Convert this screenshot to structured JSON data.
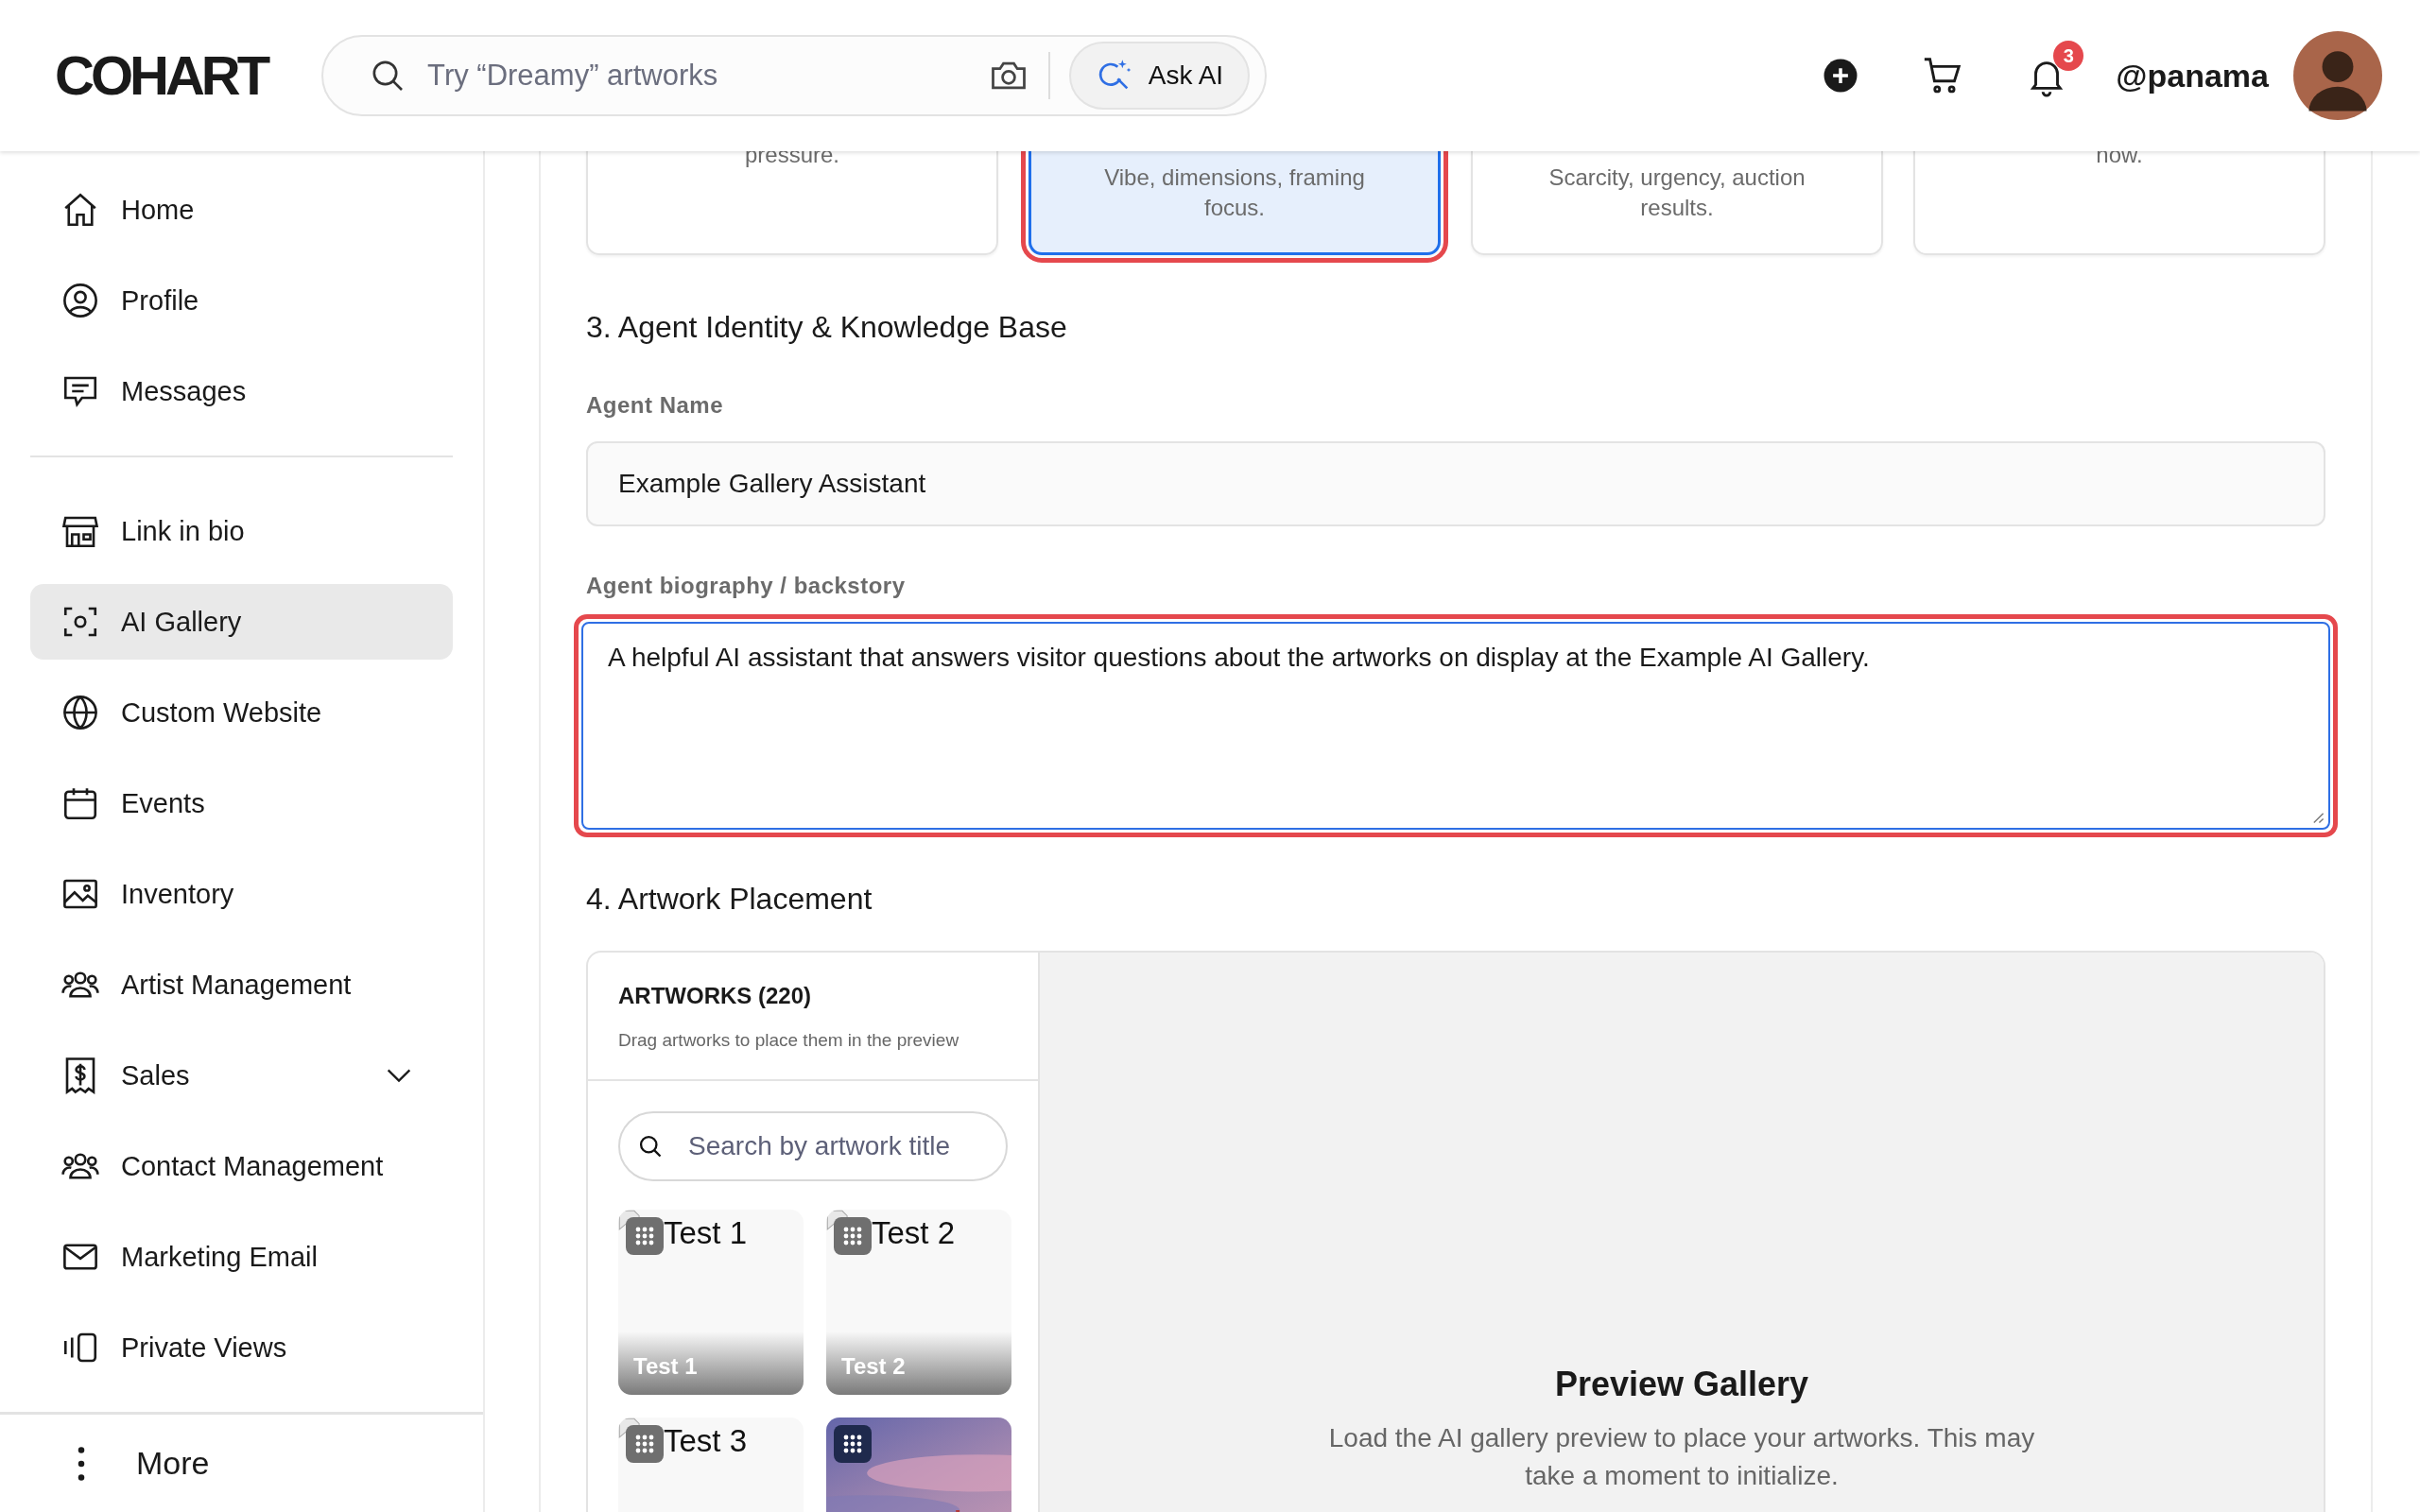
{
  "header": {
    "logo": "COHART",
    "search": {
      "placeholder": "Try “Dreamy” artworks"
    },
    "ask_ai": "Ask AI",
    "notifications": "3",
    "username": "@panama"
  },
  "sidebar": {
    "groups": [
      [
        {
          "label": "Home",
          "selected": false
        },
        {
          "label": "Profile",
          "selected": false
        },
        {
          "label": "Messages",
          "selected": false
        }
      ],
      [
        {
          "label": "Link in bio",
          "selected": false
        },
        {
          "label": "AI Gallery",
          "selected": true
        },
        {
          "label": "Custom Website",
          "selected": false
        },
        {
          "label": "Events",
          "selected": false
        },
        {
          "label": "Inventory",
          "selected": false
        },
        {
          "label": "Artist Management",
          "selected": false
        },
        {
          "label": "Sales",
          "selected": false,
          "expanded": false
        },
        {
          "label": "Contact Management",
          "selected": false
        },
        {
          "label": "Marketing Email",
          "selected": false
        },
        {
          "label": "Private Views",
          "selected": false
        }
      ]
    ],
    "more": "More"
  },
  "style_cards": [
    {
      "text": "pressure.",
      "selected": false,
      "highlighted": false
    },
    {
      "text": "Vibe, dimensions, framing focus.",
      "selected": true,
      "highlighted": true
    },
    {
      "text": "Scarcity, urgency, auction results.",
      "selected": false,
      "highlighted": false
    },
    {
      "text": "now.",
      "selected": false,
      "highlighted": false
    }
  ],
  "identity": {
    "heading": "3. Agent Identity & Knowledge Base",
    "name_label": "Agent Name",
    "name_value": "Example Gallery Assistant",
    "bio_label": "Agent biography / backstory",
    "bio_value": "A helpful AI assistant that answers visitor questions about the artworks on display at the Example AI Gallery.",
    "bio_highlighted": true
  },
  "placement": {
    "heading": "4. Artwork Placement",
    "artworks_title": "ARTWORKS (220)",
    "artworks_hint": "Drag artworks to place them in the preview",
    "search": {
      "placeholder": "Search by artwork title"
    },
    "artworks": [
      {
        "kind": "broken",
        "alt": "Test 1",
        "caption": "Test 1"
      },
      {
        "kind": "broken",
        "alt": "Test 2",
        "caption": "Test 2"
      },
      {
        "kind": "broken",
        "alt": "Test 3"
      },
      {
        "kind": "picture"
      }
    ],
    "preview_title": "Preview Gallery",
    "preview_text": "Load the AI gallery preview to place your artworks. This may take a moment to initialize."
  }
}
